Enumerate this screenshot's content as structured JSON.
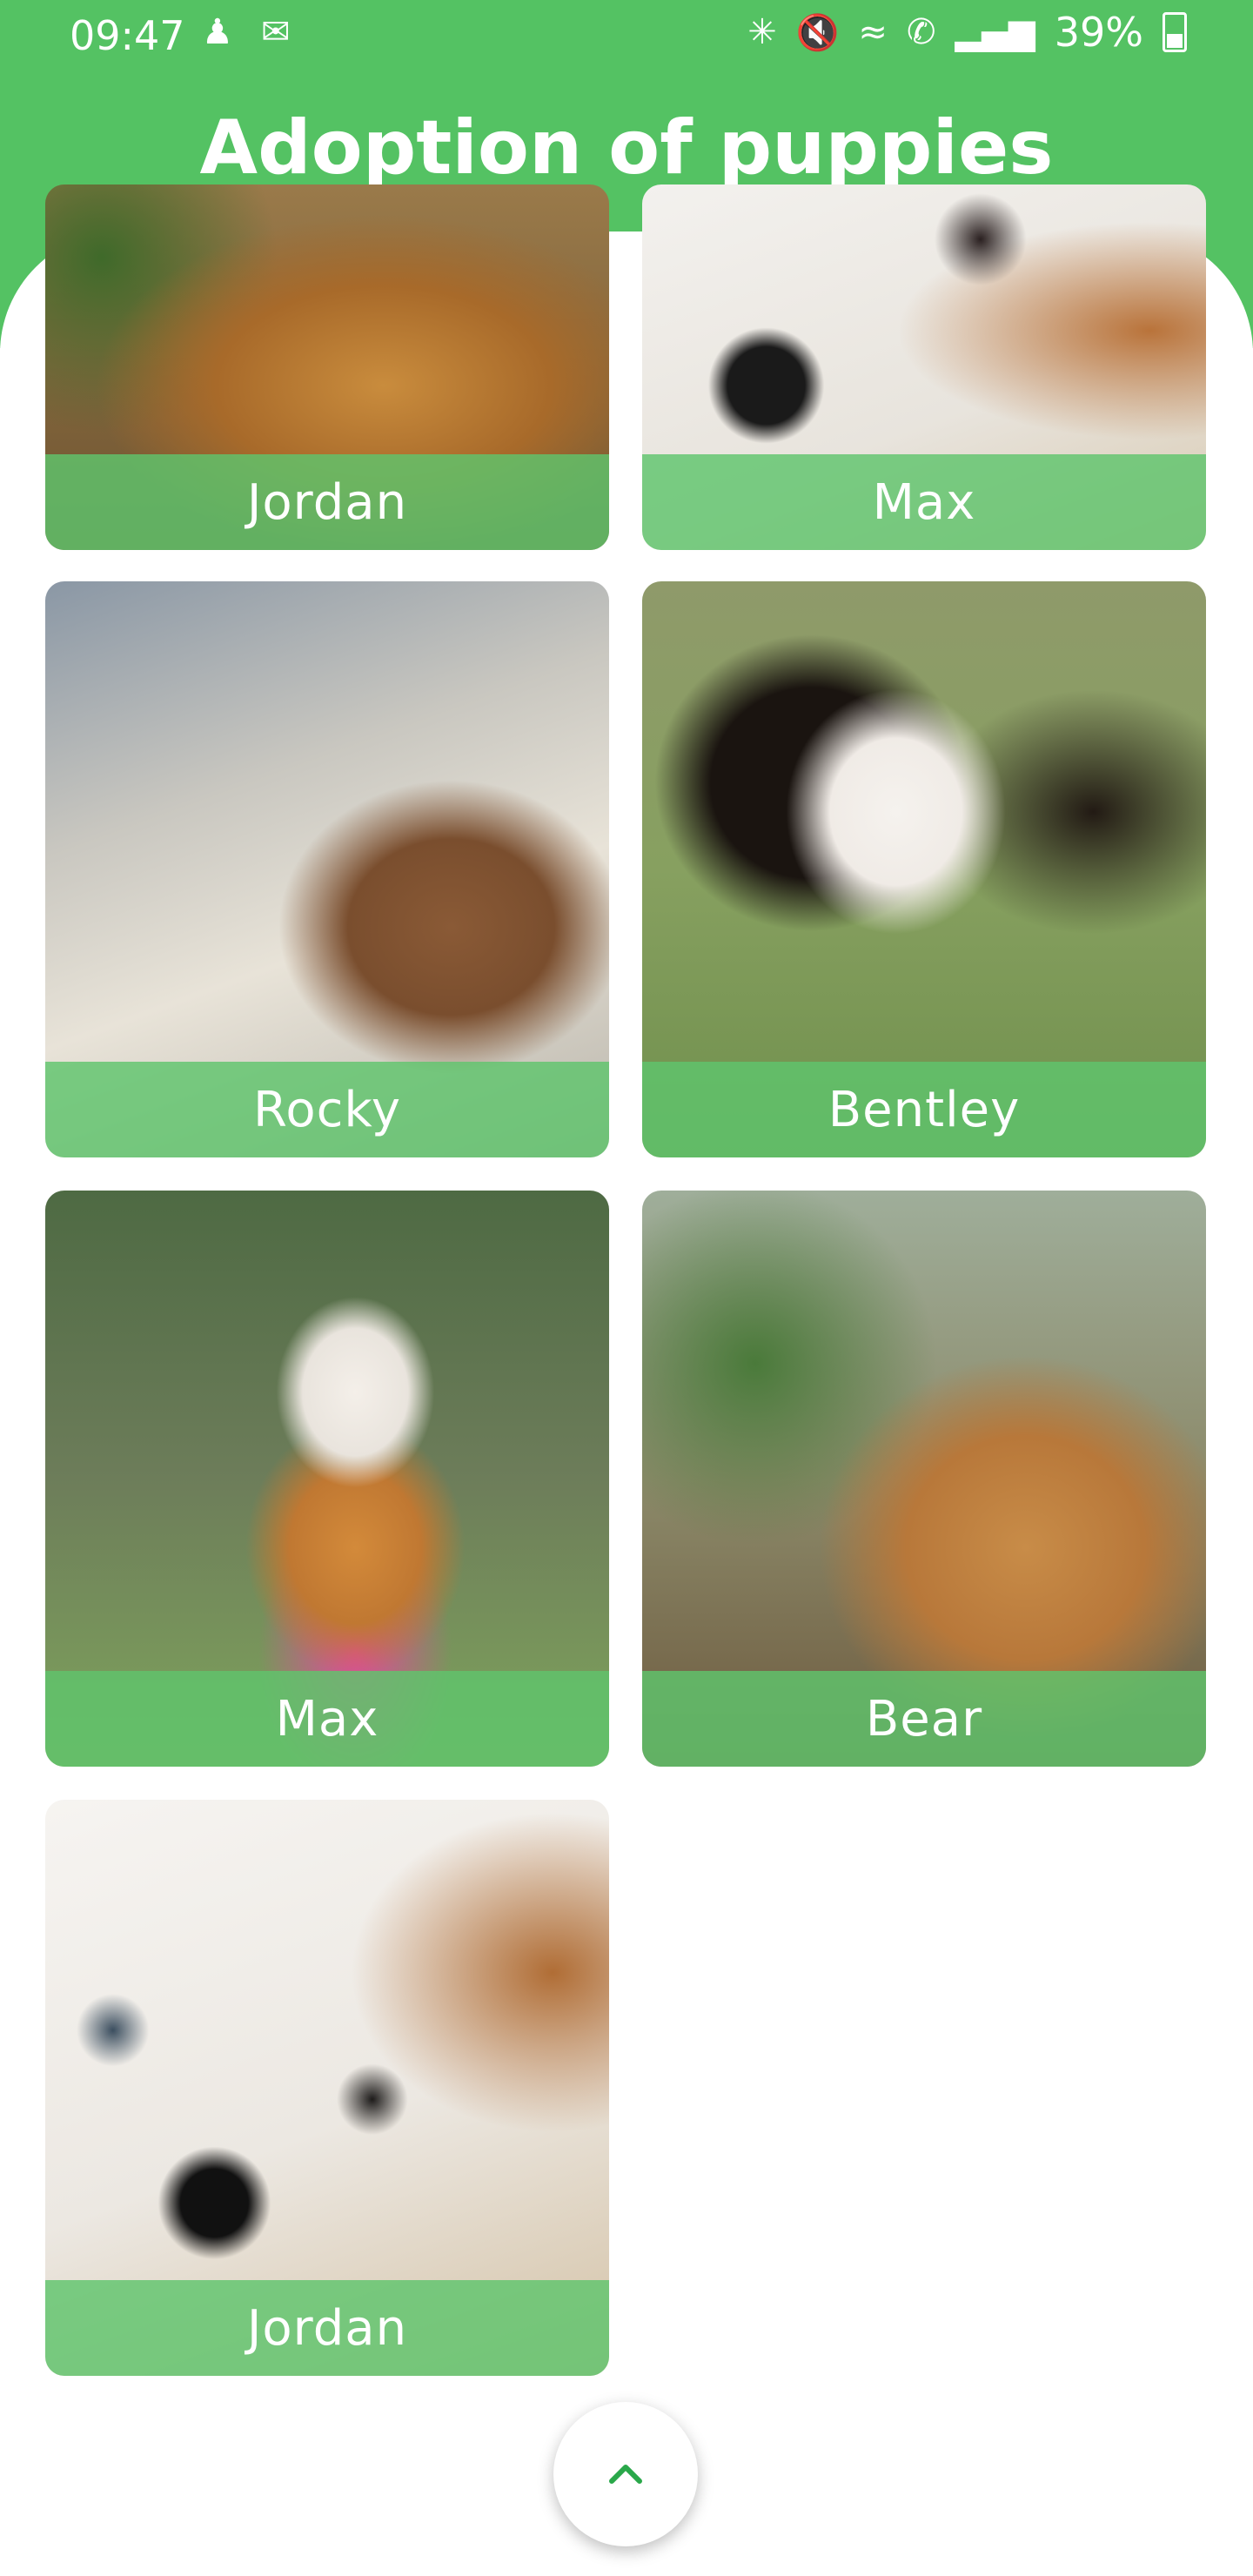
{
  "status_bar": {
    "time": "09:47",
    "battery_percent": "39%"
  },
  "header": {
    "title": "Adoption of puppies"
  },
  "puppies": [
    {
      "name": "Jordan"
    },
    {
      "name": "Max"
    },
    {
      "name": "Rocky"
    },
    {
      "name": "Bentley"
    },
    {
      "name": "Max"
    },
    {
      "name": "Bear"
    },
    {
      "name": "Jordan"
    }
  ],
  "colors": {
    "accent": "#54c263",
    "label_band": "#5fc46c",
    "fab_icon": "#2aa84a"
  },
  "icons": {
    "fab": "chevron-up-icon"
  }
}
